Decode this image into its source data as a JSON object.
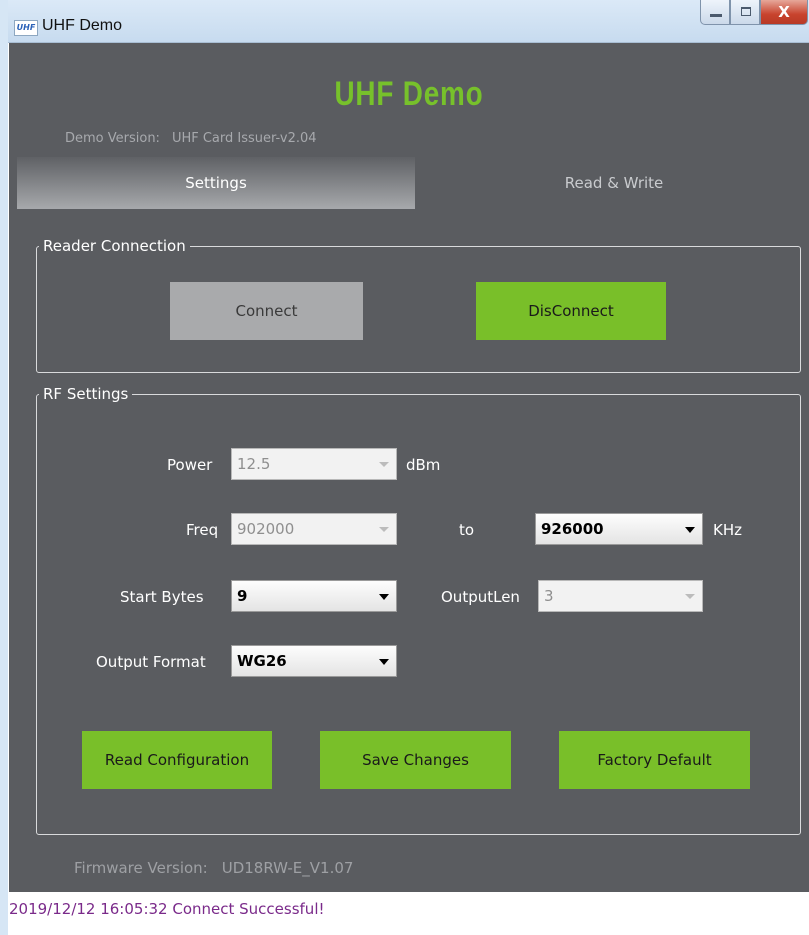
{
  "window": {
    "icon_text": "UHF",
    "title": "UHF Demo",
    "close_glyph": "X"
  },
  "app": {
    "heading": "UHF Demo",
    "demo_version_label": "Demo Version:",
    "demo_version_value": "UHF Card Issuer-v2.04"
  },
  "tabs": [
    {
      "label": "Settings",
      "selected": true
    },
    {
      "label": "Read & Write",
      "selected": false
    }
  ],
  "reader_connection": {
    "title": "Reader Connection",
    "connect_label": "Connect",
    "disconnect_label": "DisConnect"
  },
  "rf_settings": {
    "title": "RF Settings",
    "power": {
      "label": "Power",
      "value": "12.5",
      "unit": "dBm"
    },
    "freq": {
      "label": "Freq",
      "from_value": "902000",
      "to_label": "to",
      "to_value": "926000",
      "unit": "KHz"
    },
    "start_bytes": {
      "label": "Start Bytes",
      "value": "9"
    },
    "output_len": {
      "label": "OutputLen",
      "value": "3"
    },
    "output_format": {
      "label": "Output Format",
      "value": "WG26"
    },
    "read_config_label": "Read Configuration",
    "save_changes_label": "Save Changes",
    "factory_default_label": "Factory Default"
  },
  "firmware": {
    "label": "Firmware Version:",
    "value": "UD18RW-E_V1.07"
  },
  "status": {
    "message": "2019/12/12 16:05:32 Connect Successful!"
  },
  "colors": {
    "accent_green": "#79bf29",
    "panel_background": "#5a5c60",
    "status_text": "#7a2a8a"
  }
}
